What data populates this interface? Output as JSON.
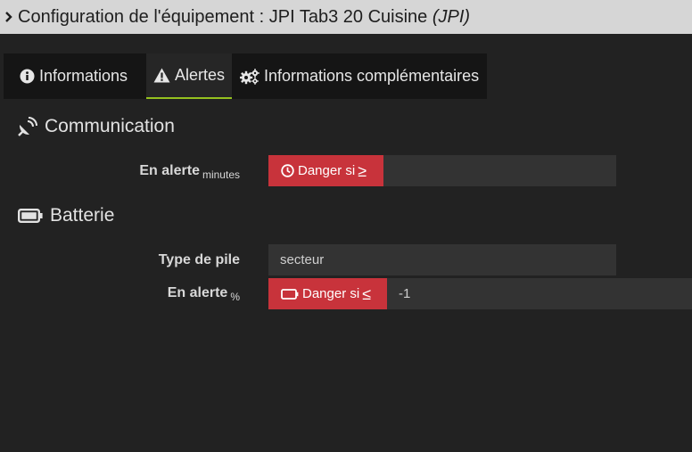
{
  "header": {
    "title_prefix": "Configuration de l'équipement : JPI Tab3 20 Cuisine",
    "title_suffix": "(JPI)",
    "expand_icon": "chevron-right-icon"
  },
  "tabs": [
    {
      "label": "Informations",
      "icon": "info-circle-icon",
      "active": false
    },
    {
      "label": "Alertes",
      "icon": "warning-icon",
      "active": true
    },
    {
      "label": "Informations complémentaires",
      "icon": "gears-icon",
      "active": false
    }
  ],
  "communication": {
    "title": "Communication",
    "icon": "satellite-dish-icon",
    "alert_label": "En alerte",
    "alert_unit": "minutes",
    "danger_label": "Danger si",
    "danger_operator": "≥",
    "danger_icon": "clock-icon",
    "value": ""
  },
  "batterie": {
    "title": "Batterie",
    "icon": "battery-icon",
    "pile_label": "Type de pile",
    "pile_value": "secteur",
    "alert_label": "En alerte",
    "alert_unit": "%",
    "danger_label": "Danger si",
    "danger_operator": "≤",
    "danger_icon": "battery-empty-icon",
    "value": "-1"
  },
  "colors": {
    "danger": "#c8333b",
    "active_tab_underline": "#95c11f",
    "background": "#222222",
    "titlebar": "#d6d6d6"
  }
}
